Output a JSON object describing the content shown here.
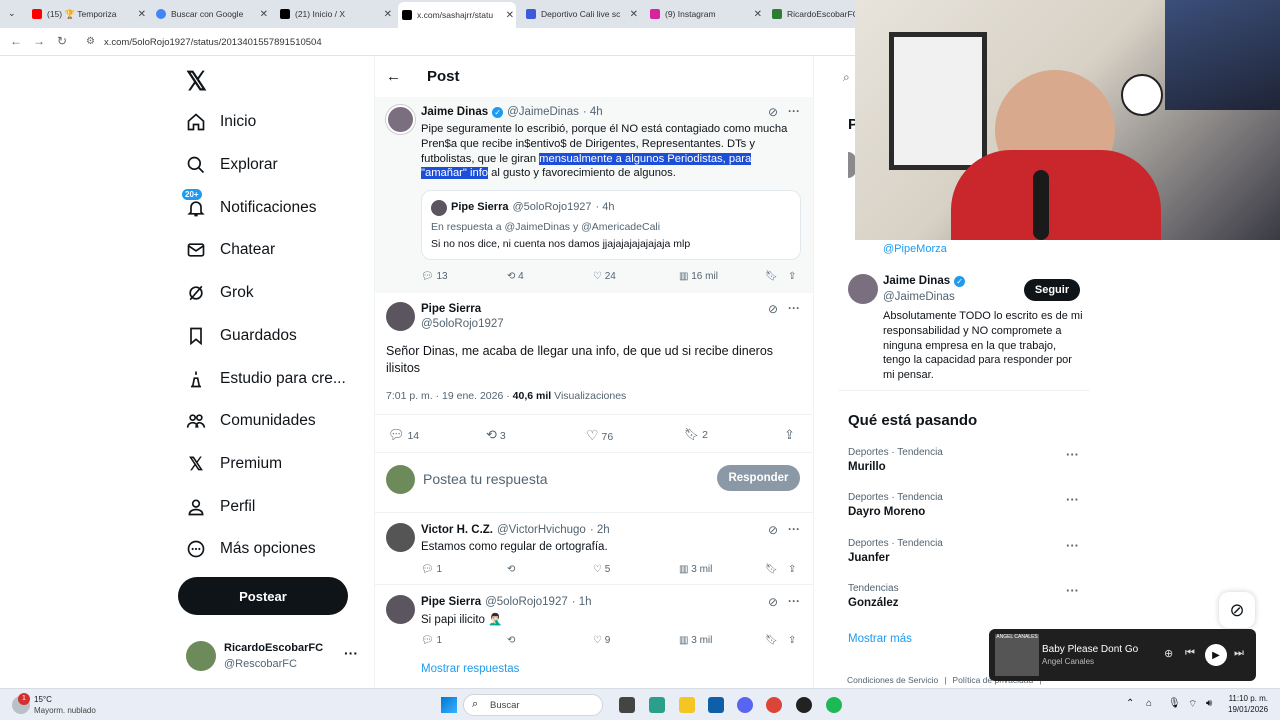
{
  "browser": {
    "tabs": [
      {
        "label": "(15) 🏆 Temporiza",
        "color": "#ff0000"
      },
      {
        "label": "Buscar con Google",
        "color": "#4285f4"
      },
      {
        "label": "(21) Inicio / X",
        "color": "#000000"
      },
      {
        "label": "x.com/sashajrr/statu",
        "color": "#000000"
      },
      {
        "label": "Deportivo Cali live sc",
        "color": "#3b5bdb"
      },
      {
        "label": "(9) Instagram",
        "color": "#d6249f"
      },
      {
        "label": "RicardoEscobarFC",
        "color": "#2e7d32"
      }
    ],
    "url": "x.com/5oloRojo1927/status/2013401557891510504"
  },
  "nav": {
    "items": [
      {
        "label": "Inicio",
        "icon": "home-icon"
      },
      {
        "label": "Explorar",
        "icon": "search-icon"
      },
      {
        "label": "Notificaciones",
        "icon": "bell-icon",
        "badge": "20+"
      },
      {
        "label": "Chatear",
        "icon": "mail-icon"
      },
      {
        "label": "Grok",
        "icon": "grok-icon"
      },
      {
        "label": "Guardados",
        "icon": "bookmark-icon"
      },
      {
        "label": "Estudio para cre...",
        "icon": "studio-icon"
      },
      {
        "label": "Comunidades",
        "icon": "communities-icon"
      },
      {
        "label": "Premium",
        "icon": "x-logo-icon"
      },
      {
        "label": "Perfil",
        "icon": "profile-icon"
      },
      {
        "label": "Más opciones",
        "icon": "more-icon"
      }
    ],
    "post_button": "Postear",
    "account": {
      "name": "RicardoEscobarFC",
      "handle": "@RescobarFC"
    }
  },
  "header": {
    "title": "Post"
  },
  "quoted_reply": {
    "name": "Jaime Dinas",
    "handle": "@JaimeDinas",
    "time": "· 4h",
    "text_before": "Pipe seguramente lo escribió, porque él NO está contagiado como mucha Pren$a que recibe in$entivo$ de Dirigentes, Representantes. DTs y futbolistas, que le giran ",
    "text_highlight": "mensualmente a algunos Periodistas, para \"amañar\" info",
    "text_after": " al gusto y favorecimiento de algunos.",
    "quote": {
      "name": "Pipe Sierra",
      "handle": "@5oloRojo1927",
      "time": "· 4h",
      "reply_to": "En respuesta a @JaimeDinas y @AmericadeCali",
      "text": "Si no nos dice, ni cuenta nos damos jjajajajajajajaja mlp"
    },
    "stats": {
      "replies": "13",
      "reposts": "4",
      "likes": "24",
      "views": "16 mil"
    }
  },
  "main_post": {
    "name": "Pipe Sierra",
    "handle": "@5oloRojo1927",
    "text": "Señor Dinas, me acaba de llegar una info, de que ud si recibe dineros ilisitos",
    "timestamp": "7:01 p. m. · 19 ene. 2026 ·",
    "views_count": "40,6 mil",
    "views_label": "Visualizaciones",
    "stats": {
      "replies": "14",
      "reposts": "3",
      "likes": "76",
      "bookmarks": "2"
    }
  },
  "composer": {
    "placeholder": "Postea tu respuesta",
    "button": "Responder"
  },
  "replies": [
    {
      "name": "Victor H. C.Z.",
      "handle": "@VictorHvichugo",
      "time": "· 2h",
      "text": "Estamos como regular de ortografía.",
      "replies": "1",
      "likes": "5",
      "views": "3 mil"
    },
    {
      "name": "Pipe Sierra",
      "handle": "@5oloRojo1927",
      "time": "· 1h",
      "text": "Si papi ilicito 🤦🏻‍♂️",
      "replies": "1",
      "likes": "9",
      "views": "3 mil"
    }
  ],
  "show_more_replies": "Mostrar respuestas",
  "right": {
    "partial_handle": "@PipeMorza",
    "partial_letter": "P",
    "follow_card": {
      "name": "Jaime Dinas",
      "handle": "@JaimeDinas",
      "button": "Seguir",
      "bio": "Absolutamente TODO lo escrito es de mi responsabilidad y NO compromete a ninguna empresa en la que trabajo, tengo la capacidad para responder por mi pensar."
    },
    "trends_title": "Qué está pasando",
    "trends": [
      {
        "category": "Deportes · Tendencia",
        "name": "Murillo"
      },
      {
        "category": "Deportes · Tendencia",
        "name": "Dayro Moreno"
      },
      {
        "category": "Deportes · Tendencia",
        "name": "Juanfer"
      },
      {
        "category": "Tendencias",
        "name": "González"
      }
    ],
    "show_more": "Mostrar más",
    "footer": [
      "Condiciones de Servicio",
      "|",
      "Política de privacidad",
      "|"
    ]
  },
  "media_player": {
    "song": "Baby Please Dont Go",
    "artist": "Angel Canales",
    "thumb_text": "ANGEL CANALES"
  },
  "taskbar": {
    "weather_temp": "15°C",
    "weather_desc": "Mayorm. nublado",
    "weather_badge": "1",
    "search": "Buscar",
    "time": "11:10 p. m.",
    "date": "19/01/2026"
  }
}
